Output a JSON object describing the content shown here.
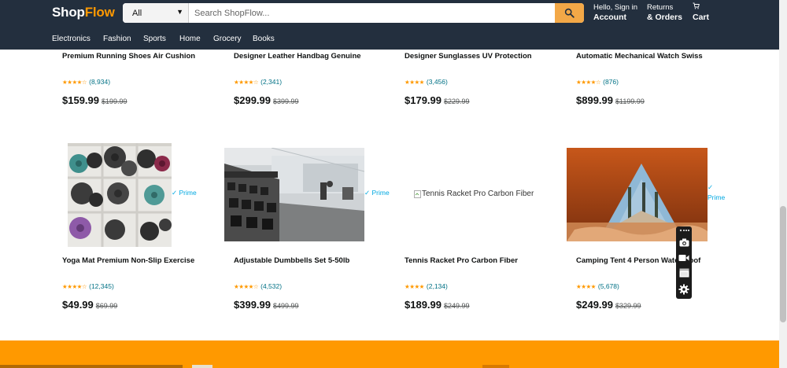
{
  "header": {
    "logo_part1": "Shop",
    "logo_part2": "Flow",
    "search_category": "All",
    "search_placeholder": "Search ShopFlow...",
    "account_small": "Hello, Sign in",
    "account_big": "Account",
    "orders_small": "Returns",
    "orders_big": "& Orders",
    "cart_label": "Cart",
    "cart_icon": "cart-icon",
    "search_icon": "magnifier-icon"
  },
  "nav": {
    "items": [
      "Electronics",
      "Fashion",
      "Sports",
      "Home",
      "Grocery",
      "Books"
    ]
  },
  "products_row1": [
    {
      "title": "Premium Running Shoes Air Cushion",
      "stars": "★★★★☆",
      "reviews": "(8,934)",
      "price": "$159.99",
      "was": "$199.99"
    },
    {
      "title": "Designer Leather Handbag Genuine",
      "stars": "★★★★☆",
      "reviews": "(2,341)",
      "price": "$299.99",
      "was": "$399.99"
    },
    {
      "title": "Designer Sunglasses UV Protection",
      "stars": "★★★★",
      "reviews": "(3,456)",
      "price": "$179.99",
      "was": "$229.99"
    },
    {
      "title": "Automatic Mechanical Watch Swiss",
      "stars": "★★★★☆",
      "reviews": "(876)",
      "price": "$899.99",
      "was": "$1199.99"
    }
  ],
  "products_row2": [
    {
      "title": "Yoga Mat Premium Non-Slip Exercise",
      "stars": "★★★★☆",
      "reviews": "(12,345)",
      "price": "$49.99",
      "was": "$69.99",
      "prime": "✓ Prime"
    },
    {
      "title": "Adjustable Dumbbells Set 5-50lb",
      "stars": "★★★★☆",
      "reviews": "(4,532)",
      "price": "$399.99",
      "was": "$499.99",
      "prime": "✓ Prime"
    },
    {
      "title": "Tennis Racket Pro Carbon Fiber",
      "stars": "★★★★",
      "reviews": "(2,134)",
      "price": "$189.99",
      "was": "$249.99",
      "image_alt": "Tennis Racket Pro Carbon Fiber"
    },
    {
      "title": "Camping Tent 4 Person Waterproof",
      "stars": "★★★★",
      "reviews": "(5,678)",
      "price": "$249.99",
      "was": "$329.99",
      "prime": "✓ Prime"
    }
  ],
  "colors": {
    "header_bg": "#232f3e",
    "accent": "#ff9900",
    "link": "#007185",
    "prime": "#00a8e1"
  }
}
